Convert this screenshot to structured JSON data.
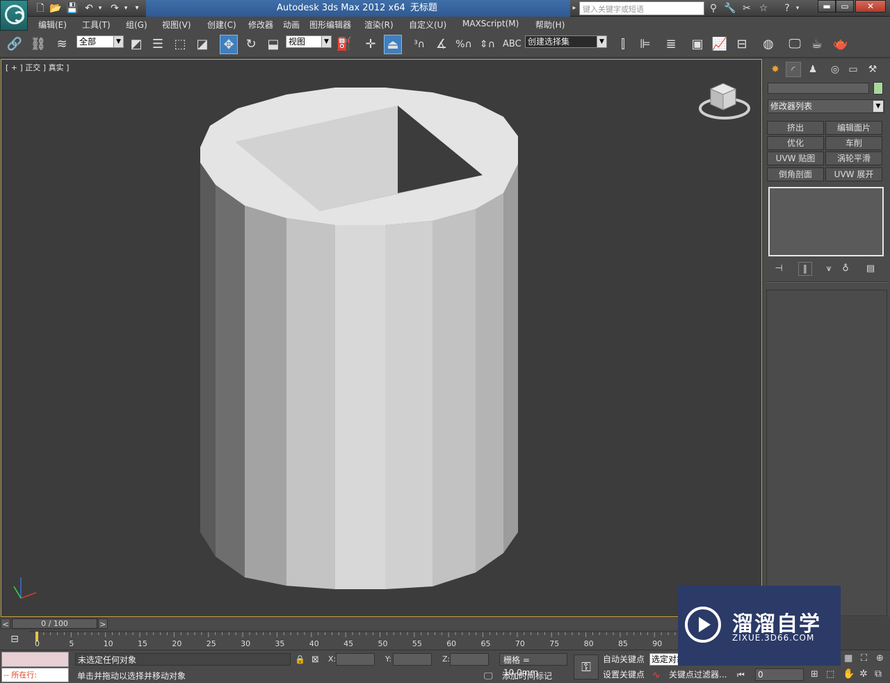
{
  "titlebar": {
    "app_title": "Autodesk 3ds Max  2012 x64",
    "doc_title": "无标题",
    "search_placeholder": "键入关键字或短语",
    "min_label": "▬",
    "max_label": "▭",
    "close_label": "✕"
  },
  "menu": [
    "编辑(E)",
    "工具(T)",
    "组(G)",
    "视图(V)",
    "创建(C)",
    "修改器",
    "动画",
    "图形编辑器",
    "渲染(R)",
    "自定义(U)",
    "MAXScript(M)",
    "帮助(H)"
  ],
  "toolbar": {
    "selection_filter": "全部",
    "ref_coord": "视图",
    "named_selection": "创建选择集"
  },
  "viewport": {
    "label": "[ + ] 正交 ] 真实 ]"
  },
  "command_panel": {
    "modifier_list": "修改器列表",
    "buttons": [
      "挤出",
      "编辑面片",
      "优化",
      "车削",
      "UVW 贴图",
      "涡轮平滑",
      "倒角剖面",
      "UVW 展开"
    ]
  },
  "timeline": {
    "frame_display": "0 / 100",
    "ticks": [
      "0",
      "5",
      "10",
      "15",
      "20",
      "25",
      "30",
      "35",
      "40",
      "45",
      "50",
      "55",
      "60",
      "65",
      "70",
      "75",
      "80",
      "85",
      "90"
    ]
  },
  "status": {
    "maxscript_prompt": "-- 所在行:",
    "selection_status": "未选定任何对象",
    "prompt": "单击并拖动以选择并移动对象",
    "x_label": "X:",
    "y_label": "Y:",
    "z_label": "Z:",
    "grid": "栅格 = 10.0mm",
    "add_time_tag": "添加时间标记",
    "auto_key": "自动关键点",
    "set_key": "设置关键点",
    "selected_dropdown": "选定对象",
    "key_filters": "关键点过滤器...",
    "frame_field": "0"
  },
  "watermark": {
    "title": "溜溜自学",
    "subtitle": "ZIXUE.3D66.COM"
  }
}
